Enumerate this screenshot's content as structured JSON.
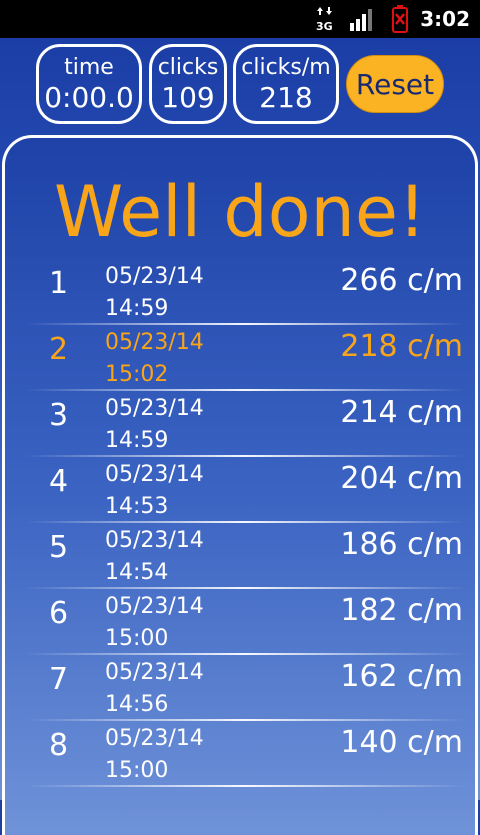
{
  "status_bar": {
    "network_label": "3G",
    "time": "3:02",
    "icons": [
      "network-3g-icon",
      "signal-bars-icon",
      "battery-alert-icon"
    ]
  },
  "stats": {
    "time": {
      "label": "time",
      "value": "0:00.0"
    },
    "clicks": {
      "label": "clicks",
      "value": "109"
    },
    "rate": {
      "label": "clicks/m",
      "value": "218"
    }
  },
  "reset_label": "Reset",
  "headline": "Well done!",
  "results": [
    {
      "rank": "1",
      "date": "05/23/14",
      "time": "14:59",
      "rate": "266 c/m",
      "highlight": false
    },
    {
      "rank": "2",
      "date": "05/23/14",
      "time": "15:02",
      "rate": "218 c/m",
      "highlight": true
    },
    {
      "rank": "3",
      "date": "05/23/14",
      "time": "14:59",
      "rate": "214 c/m",
      "highlight": false
    },
    {
      "rank": "4",
      "date": "05/23/14",
      "time": "14:53",
      "rate": "204 c/m",
      "highlight": false
    },
    {
      "rank": "5",
      "date": "05/23/14",
      "time": "14:54",
      "rate": "186 c/m",
      "highlight": false
    },
    {
      "rank": "6",
      "date": "05/23/14",
      "time": "15:00",
      "rate": "182 c/m",
      "highlight": false
    },
    {
      "rank": "7",
      "date": "05/23/14",
      "time": "14:56",
      "rate": "162 c/m",
      "highlight": false
    },
    {
      "rank": "8",
      "date": "05/23/14",
      "time": "15:00",
      "rate": "140 c/m",
      "highlight": false
    }
  ],
  "colors": {
    "accent": "#f9a51a",
    "reset_button": "#fbb323",
    "background_top": "#1b3ea6",
    "background_bottom": "#6e90d6",
    "text": "#ffffff"
  }
}
